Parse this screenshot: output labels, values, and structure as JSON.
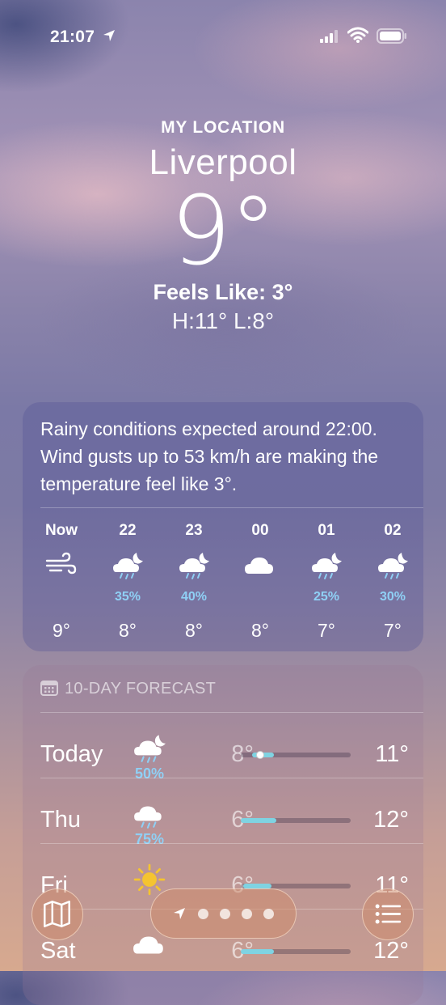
{
  "status_bar": {
    "time": "21:07"
  },
  "header": {
    "my_location_label": "MY LOCATION",
    "city": "Liverpool",
    "temperature": "9°",
    "feels_like": "Feels Like: 3°",
    "high_low": "H:11°  L:8°"
  },
  "hourly": {
    "summary": "Rainy conditions expected around 22:00. Wind gusts up to 53 km/h are making the temperature feel like 3°.",
    "items": [
      {
        "label": "Now",
        "icon": "wind-icon",
        "pct": "",
        "temp": "9°"
      },
      {
        "label": "22",
        "icon": "rain-moon-icon",
        "pct": "35%",
        "temp": "8°"
      },
      {
        "label": "23",
        "icon": "rain-moon-icon",
        "pct": "40%",
        "temp": "8°"
      },
      {
        "label": "00",
        "icon": "cloud-icon",
        "pct": "",
        "temp": "8°"
      },
      {
        "label": "01",
        "icon": "rain-moon-icon",
        "pct": "25%",
        "temp": "7°"
      },
      {
        "label": "02",
        "icon": "rain-moon-icon",
        "pct": "30%",
        "temp": "7°"
      }
    ]
  },
  "daily": {
    "header": "10-DAY FORECAST",
    "rows": [
      {
        "day": "Today",
        "icon": "rain-moon-icon",
        "pct": "50%",
        "low": "8°",
        "high": "11°",
        "bar_start": 0.1,
        "bar_end": 0.3,
        "current": 0.18
      },
      {
        "day": "Thu",
        "icon": "rain-cloud-icon",
        "pct": "75%",
        "low": "6°",
        "high": "12°",
        "bar_start": 0.0,
        "bar_end": 0.32,
        "current": null
      },
      {
        "day": "Fri",
        "icon": "sun-icon",
        "pct": "",
        "low": "6°",
        "high": "11°",
        "bar_start": 0.02,
        "bar_end": 0.28,
        "current": null
      },
      {
        "day": "Sat",
        "icon": "cloud-icon",
        "pct": "",
        "low": "6°",
        "high": "12°",
        "bar_start": 0.0,
        "bar_end": 0.3,
        "current": null
      }
    ]
  },
  "colors": {
    "precip": "#8fd0f5",
    "bar": "#7fd3e2"
  }
}
